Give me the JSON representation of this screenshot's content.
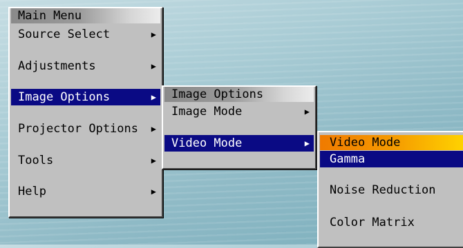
{
  "main_menu": {
    "title": "Main Menu",
    "items": [
      {
        "label": "Source Select",
        "arrow": "▶"
      },
      {
        "label": "Adjustments",
        "arrow": "▶"
      },
      {
        "label": "Image Options",
        "arrow": "▶"
      },
      {
        "label": "Projector Options",
        "arrow": "▶"
      },
      {
        "label": "Tools",
        "arrow": "▶"
      },
      {
        "label": "Help",
        "arrow": "▶"
      }
    ],
    "selected": "Image Options"
  },
  "image_options_menu": {
    "title": "Image Options",
    "items": [
      {
        "label": "Image Mode",
        "arrow": "▶"
      },
      {
        "label": "Video Mode",
        "arrow": "▶"
      }
    ],
    "selected": "Video Mode"
  },
  "video_mode_menu": {
    "title": "Video Mode",
    "items": [
      {
        "label": "Gamma"
      },
      {
        "label": "Noise Reduction"
      },
      {
        "label": "Color Matrix"
      }
    ],
    "selected": "Gamma"
  },
  "colors": {
    "selection": "#0a0a84",
    "menu_bg": "#c0c0c0",
    "video_title_start": "#f07a00",
    "video_title_end": "#ffd400"
  }
}
